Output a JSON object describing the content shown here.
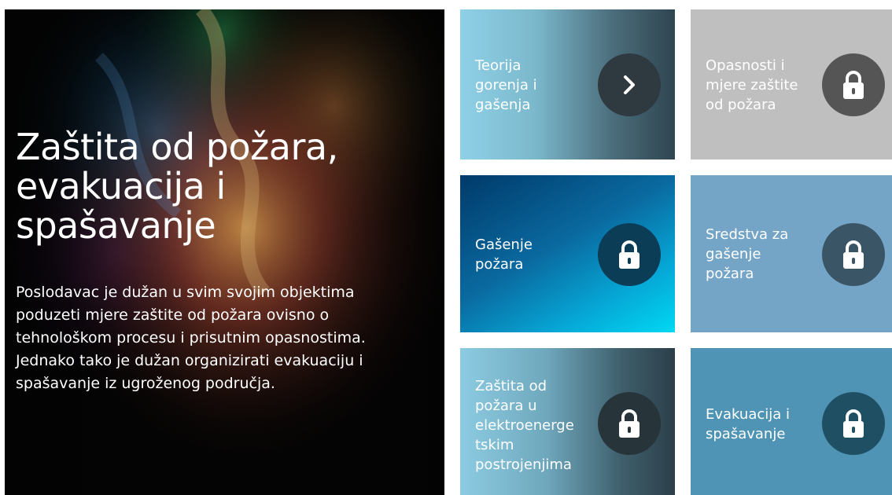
{
  "hero": {
    "title_lines": [
      "Zaštita od požara,",
      "evakuacija i",
      "spašavanje"
    ],
    "description_lines": [
      "Poslodavac je dužan u svim svojim objektima",
      "poduzeti mjere zaštite od požara ovisno o",
      "tehnološkom procesu i prisutnim opasnostima.",
      "Jednako tako je dužan organizirati evakuaciju i",
      "spašavanje iz ugroženog područja."
    ]
  },
  "tiles": [
    {
      "lines": [
        "Teorija",
        "gorenja i",
        "gašenja"
      ],
      "icon": "chevron-right-icon",
      "status": "unlocked",
      "button_color": "#2f3a40"
    },
    {
      "lines": [
        "Opasnosti i",
        "mjere zaštite",
        "od požara"
      ],
      "icon": "lock-icon",
      "status": "locked",
      "button_color": "#555555"
    },
    {
      "lines": [
        "Gašenje",
        "požara"
      ],
      "icon": "lock-icon",
      "status": "locked",
      "button_color": "#0b3d56"
    },
    {
      "lines": [
        "Sredstva za",
        "gašenje",
        "požara"
      ],
      "icon": "lock-icon",
      "status": "locked",
      "button_color": "#3a5566"
    },
    {
      "lines": [
        "Zaštita od",
        "požara u",
        "elektroenerge",
        "tskim",
        "postrojenjima"
      ],
      "icon": "lock-icon",
      "status": "locked",
      "button_color": "#27343a"
    },
    {
      "lines": [
        "Evakuacija i",
        "spašavanje"
      ],
      "icon": "lock-icon",
      "status": "locked",
      "button_color": "#1f4f63"
    }
  ]
}
